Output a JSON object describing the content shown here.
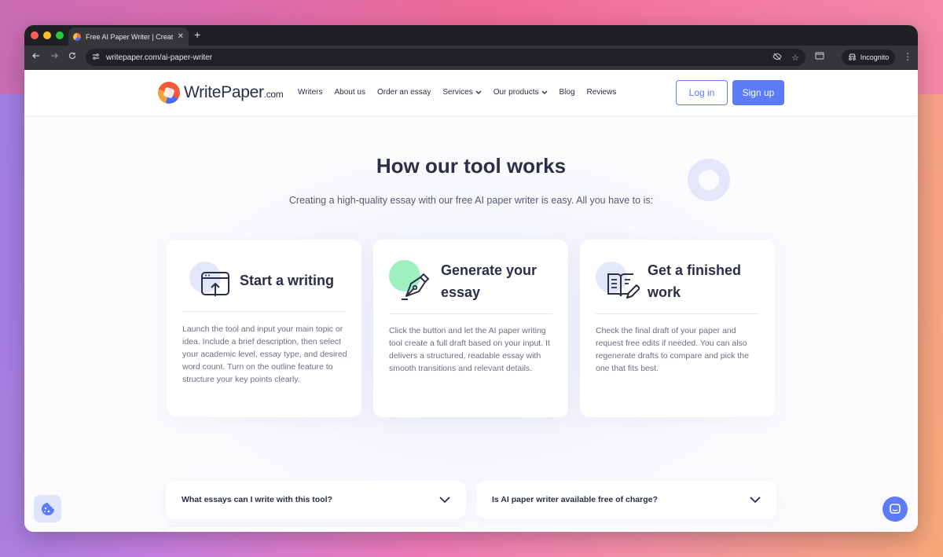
{
  "browser": {
    "tab_title": "Free AI Paper Writer | Create",
    "tab_close": "✕",
    "new_tab": "+",
    "url": "writepaper.com/ai-paper-writer",
    "incognito_label": "Incognito"
  },
  "header": {
    "logo_main": "WritePaper",
    "logo_suffix": ".com",
    "nav": [
      {
        "label": "Writers"
      },
      {
        "label": "About us"
      },
      {
        "label": "Order an essay"
      },
      {
        "label": "Services"
      },
      {
        "label": "Our products"
      },
      {
        "label": "Blog"
      },
      {
        "label": "Reviews"
      }
    ],
    "login_label": "Log in",
    "signup_label": "Sign up"
  },
  "section": {
    "title": "How our tool works",
    "subtitle": "Creating a high-quality essay with our free AI paper writer is easy. All you have to is:"
  },
  "cards": [
    {
      "title": "Start a writing",
      "body": "Launch the tool and input your main topic or idea. Include a brief description, then select your academic level, essay type, and desired word count. Turn on the outline feature to structure your key points clearly.",
      "icon": "upload-window-icon"
    },
    {
      "title": "Generate your essay",
      "body": "Click the button and let the AI paper writing tool create a full draft based on your input. It delivers a structured, readable essay with smooth transitions and relevant details.",
      "icon": "pen-nib-icon"
    },
    {
      "title": "Get a finished work",
      "body": "Check the final draft of your paper and request free edits if needed. You can also regenerate drafts to compare and pick the one that fits best.",
      "icon": "book-edit-icon"
    }
  ],
  "faq": [
    {
      "question": "What essays can I write with this tool?"
    },
    {
      "question": "Is AI paper writer available free of charge?"
    }
  ],
  "colors": {
    "accent": "#5b7cf6",
    "text_dark": "#2b2f45",
    "blob_blue": "#e3e7fb",
    "blob_green": "#9ef0bf"
  }
}
